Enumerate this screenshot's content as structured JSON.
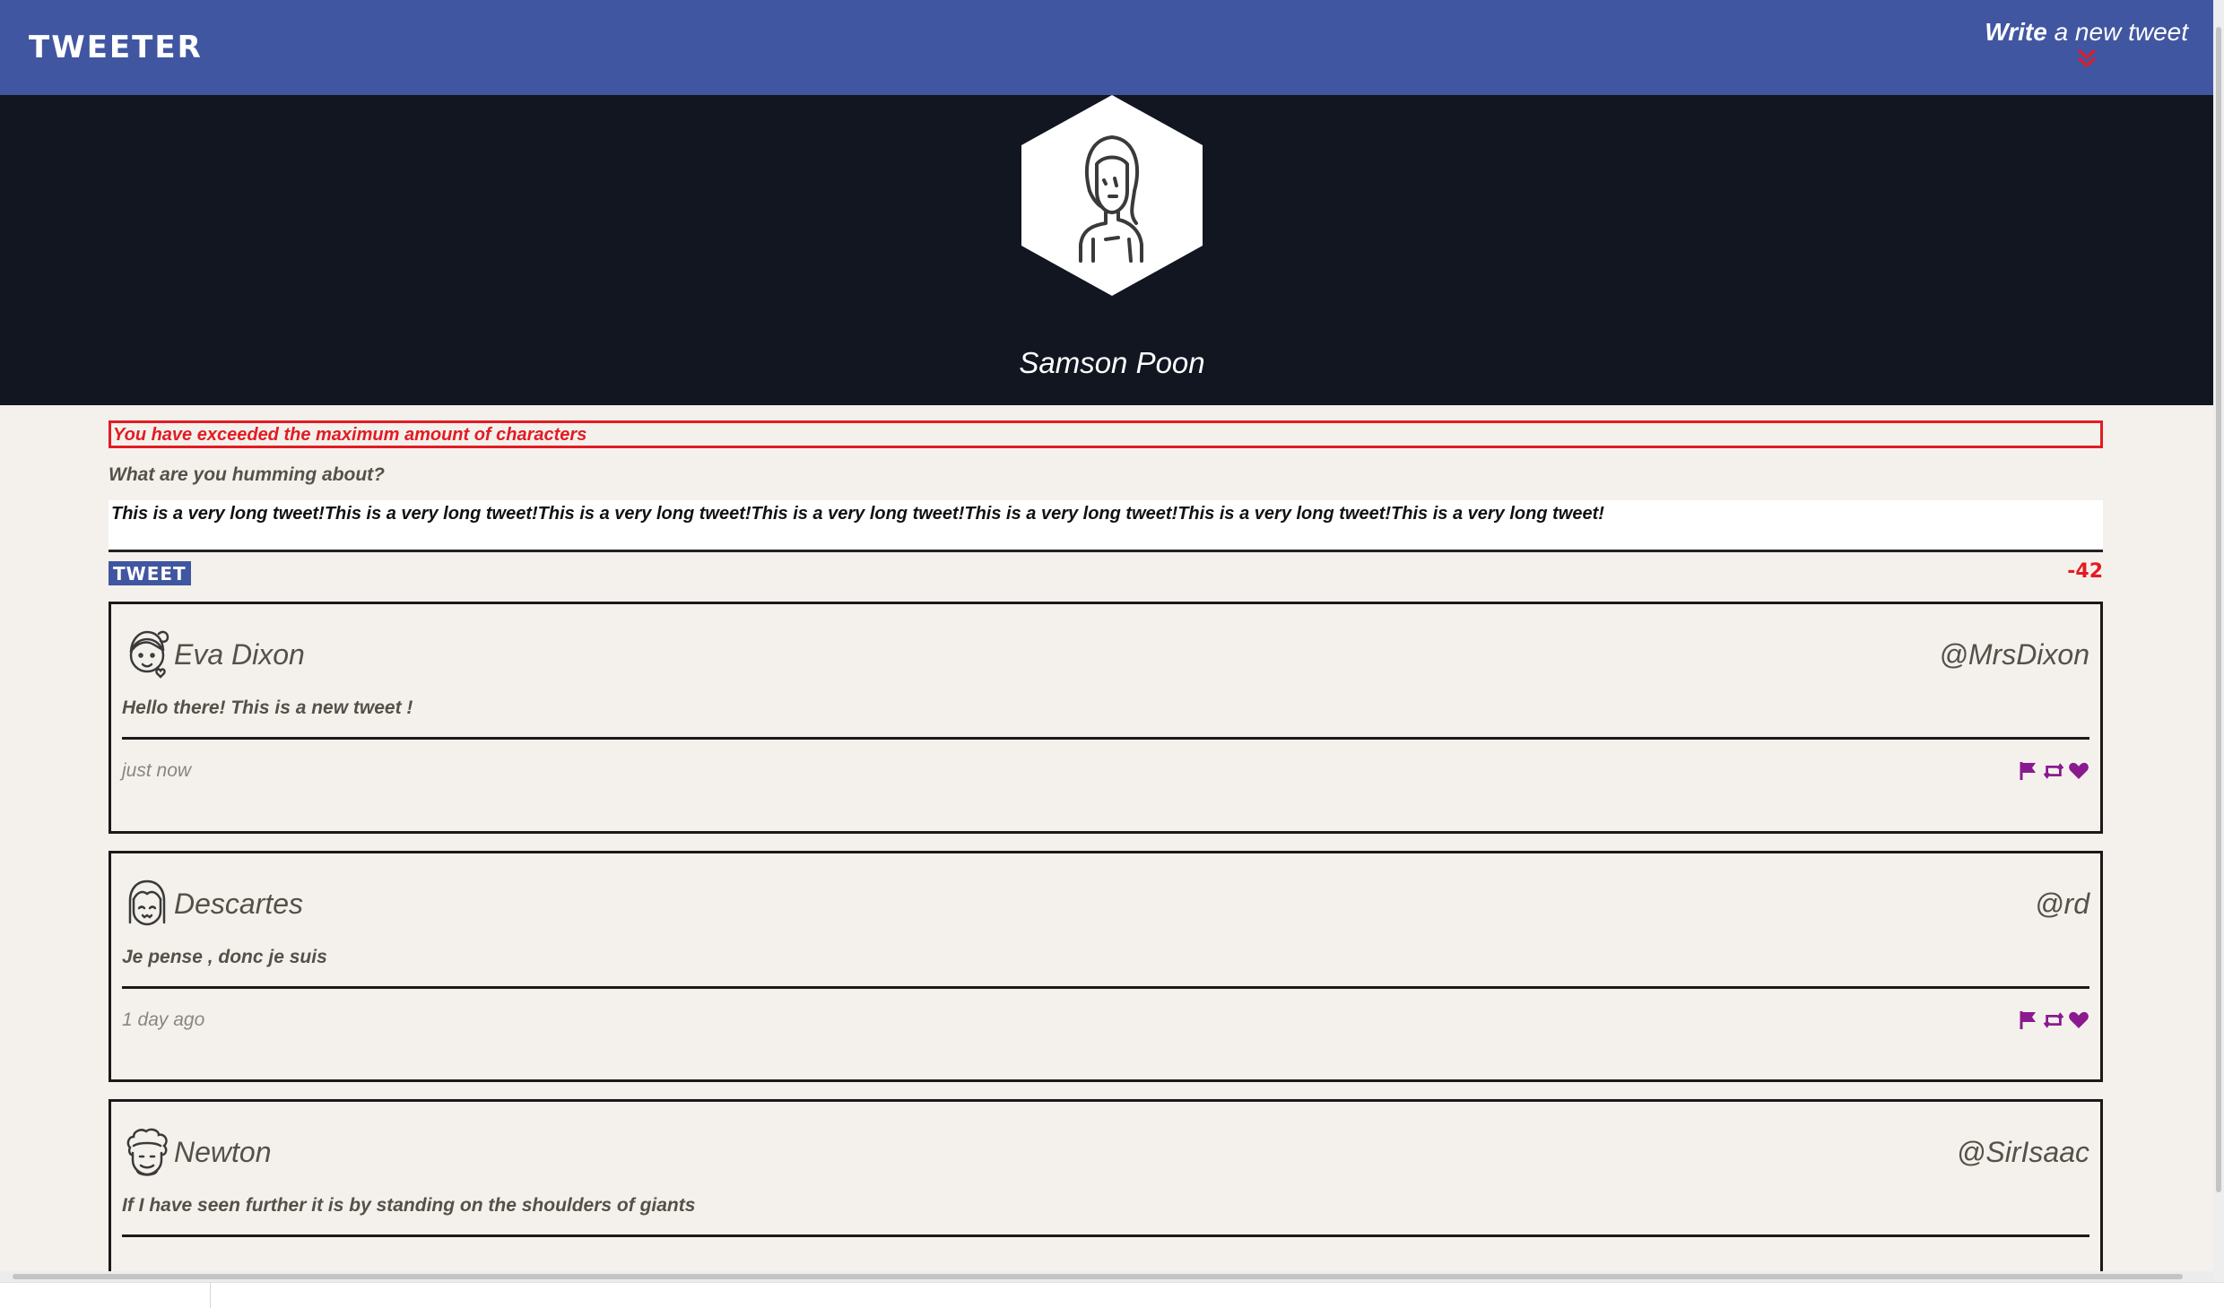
{
  "nav": {
    "brand": "TWEETER",
    "write_bold": "Write",
    "write_rest": "a new tweet",
    "write_icon": "double-chevron-down-icon"
  },
  "profile": {
    "name": "Samson Poon",
    "avatar": "woman-avatar-icon"
  },
  "compose": {
    "error": "You have exceeded the maximum amount of characters",
    "prompt": "What are you humming about?",
    "value": "This is a very long tweet!This is a very long tweet!This is a very long tweet!This is a very long tweet!This is a very long tweet!This is a very long tweet!This is a very long tweet!",
    "button": "TWEET",
    "counter": "-42"
  },
  "tweets": [
    {
      "name": "Eva Dixon",
      "handle": "@MrsDixon",
      "text": "Hello there! This is a new tweet !",
      "time": "just now",
      "avatar": "girl-avatar-icon"
    },
    {
      "name": "Descartes",
      "handle": "@rd",
      "text": "Je pense , donc je suis",
      "time": "1 day ago",
      "avatar": "bangs-avatar-icon"
    },
    {
      "name": "Newton",
      "handle": "@SirIsaac",
      "text": "If I have seen further it is by standing on the shoulders of giants",
      "time": "",
      "avatar": "curly-hair-avatar-icon"
    }
  ],
  "colors": {
    "nav": "#4056a1",
    "header": "#121621",
    "background": "#f4f1ec",
    "error": "#e31b23",
    "action": "#8a1a8f"
  }
}
